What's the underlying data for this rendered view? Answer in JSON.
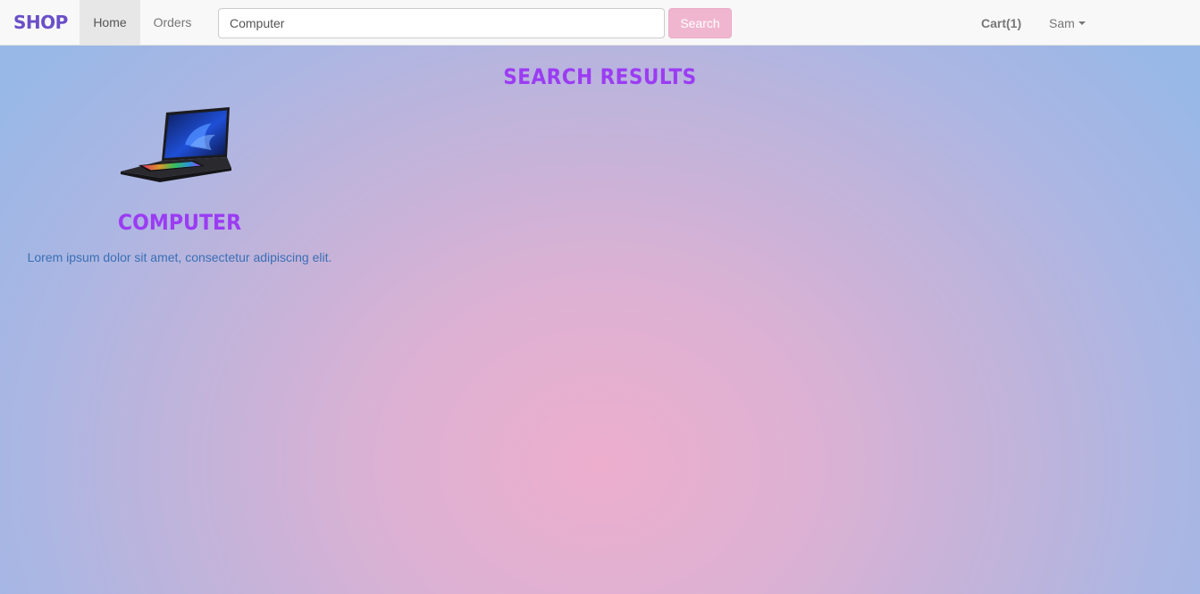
{
  "navbar": {
    "brand": "SHOP",
    "links": [
      {
        "label": "Home",
        "active": true
      },
      {
        "label": "Orders",
        "active": false
      }
    ],
    "search": {
      "value": "Computer",
      "button_label": "Search"
    },
    "cart_label": "Cart(1)",
    "user_name": "Sam",
    "user_menu_icon": "caret-down-icon"
  },
  "main": {
    "title": "SEARCH RESULTS",
    "products": [
      {
        "image_icon": "laptop-image",
        "name": "COMPUTER",
        "description": "Lorem ipsum dolor sit amet, consectetur adipiscing elit."
      }
    ]
  },
  "colors": {
    "brand": "#6a4fc8",
    "heading": "#9b3cf3",
    "search_button": "#f0b6d0",
    "description_text": "#3a6fb4"
  }
}
